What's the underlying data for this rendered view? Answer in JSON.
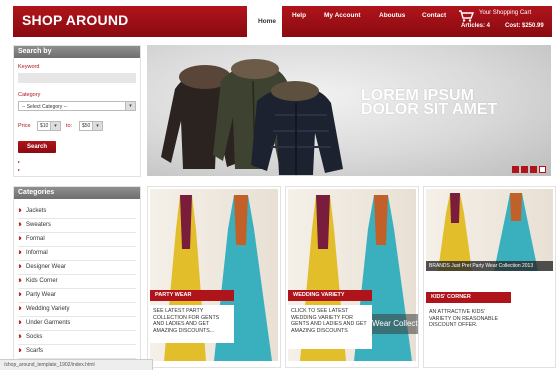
{
  "header": {
    "logo": "SHOP AROUND",
    "nav": [
      "Home",
      "Help",
      "My Account",
      "Aboutus",
      "Contact"
    ],
    "cart": {
      "title": "Your Shopping Cart",
      "articles_label": "Articles: 4",
      "cost_label": "Cost: $250.99"
    }
  },
  "search": {
    "heading": "Search by",
    "keyword_label": "Keyword",
    "keyword_value": "",
    "category_label": "Category",
    "category_selected": "-- Select Category --",
    "price_label": "Price",
    "price_from": "$10",
    "to_label": "to:",
    "price_to": "$50",
    "button": "Search"
  },
  "banner": {
    "headline": "LOREM IPSUM DOLOR SIT AMET",
    "slide_count": 4,
    "active_slide": 4
  },
  "categories": {
    "heading": "Categories",
    "items": [
      "Jackets",
      "Sweaters",
      "Formal",
      "Informal",
      "Designer Wear",
      "Kids Corner",
      "Party Wear",
      "Wedding Variety",
      "Under Garments",
      "Socks",
      "Scarfs"
    ]
  },
  "products": [
    {
      "tag": "PARTY WEAR",
      "desc": "SEE LATEST PARTY COLLECTION FOR GENTS AND LADIES AND GET AMAZING DISCOUNTS..."
    },
    {
      "tag": "WEDDING VARIETY",
      "desc": "CLICK TO SEE LATEST WEDDING VARIETY FOR GENTS AND LADIES AND GET AMAZING DISCOUNTS",
      "overlay": "Wear Collecti"
    },
    {
      "tag": "KIDS' CORNER",
      "desc": "AN ATTRACTIVE KIDS' VARIETY ON REASONABLE DISCOUNT OFFER.",
      "strip": "BRANDS Just Pret Party Wear Collection 2013"
    }
  ],
  "statusbar": "/shop_around_template_1902/index.html",
  "colors": {
    "brand_red": "#b0141b",
    "box_header": "#7a7a7a"
  }
}
